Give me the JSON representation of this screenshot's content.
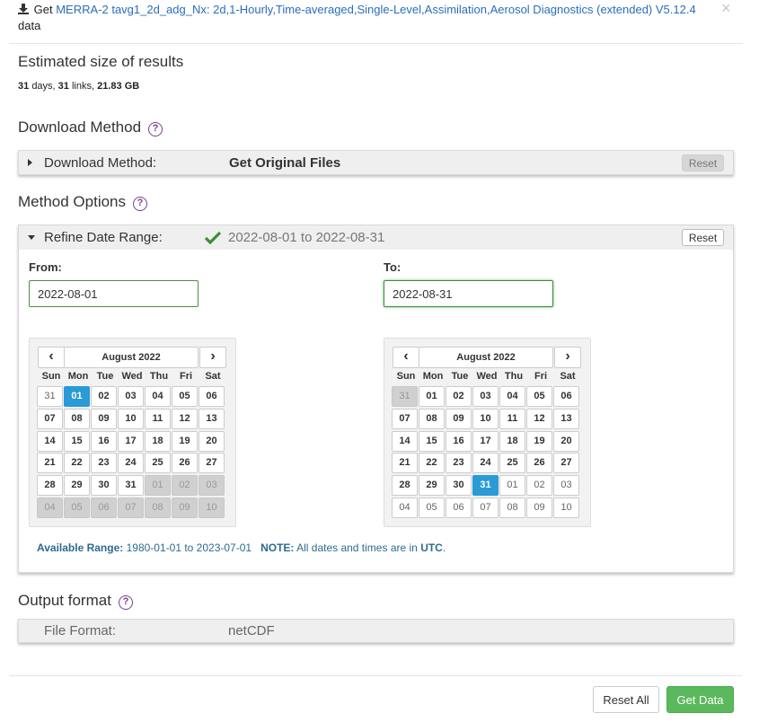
{
  "header": {
    "prefix": "Get",
    "dataset_link": "MERRA-2 tavg1_2d_adg_Nx: 2d,1-Hourly,Time-averaged,Single-Level,Assimilation,Aerosol Diagnostics (extended) V5.12.4",
    "suffix": "data",
    "close": "×"
  },
  "estimate": {
    "title": "Estimated size of results",
    "days": "31",
    "days_label": "days,",
    "links": "31",
    "links_label": "links,",
    "size": "21.83 GB"
  },
  "download_method": {
    "title": "Download Method",
    "help": "?",
    "label": "Download Method:",
    "value": "Get Original Files",
    "reset": "Reset"
  },
  "method_options": {
    "title": "Method Options",
    "help": "?",
    "refine_label": "Refine Date Range:",
    "refine_value": "2022-08-01 to 2022-08-31",
    "reset": "Reset",
    "from_label": "From:",
    "from_value": "2022-08-01",
    "to_label": "To:",
    "to_value": "2022-08-31",
    "from_calendar": {
      "title": "August 2022",
      "prev": "‹",
      "next": "›",
      "dow": [
        "Sun",
        "Mon",
        "Tue",
        "Wed",
        "Thu",
        "Fri",
        "Sat"
      ],
      "days": [
        {
          "d": "31",
          "state": "other"
        },
        {
          "d": "01",
          "state": "active"
        },
        {
          "d": "02",
          "state": "normal"
        },
        {
          "d": "03",
          "state": "normal"
        },
        {
          "d": "04",
          "state": "normal"
        },
        {
          "d": "05",
          "state": "normal"
        },
        {
          "d": "06",
          "state": "normal"
        },
        {
          "d": "07",
          "state": "normal"
        },
        {
          "d": "08",
          "state": "normal"
        },
        {
          "d": "09",
          "state": "normal"
        },
        {
          "d": "10",
          "state": "normal"
        },
        {
          "d": "11",
          "state": "normal"
        },
        {
          "d": "12",
          "state": "normal"
        },
        {
          "d": "13",
          "state": "normal"
        },
        {
          "d": "14",
          "state": "normal"
        },
        {
          "d": "15",
          "state": "normal"
        },
        {
          "d": "16",
          "state": "normal"
        },
        {
          "d": "17",
          "state": "normal"
        },
        {
          "d": "18",
          "state": "normal"
        },
        {
          "d": "19",
          "state": "normal"
        },
        {
          "d": "20",
          "state": "normal"
        },
        {
          "d": "21",
          "state": "normal"
        },
        {
          "d": "22",
          "state": "normal"
        },
        {
          "d": "23",
          "state": "normal"
        },
        {
          "d": "24",
          "state": "normal"
        },
        {
          "d": "25",
          "state": "normal"
        },
        {
          "d": "26",
          "state": "normal"
        },
        {
          "d": "27",
          "state": "normal"
        },
        {
          "d": "28",
          "state": "normal"
        },
        {
          "d": "29",
          "state": "normal"
        },
        {
          "d": "30",
          "state": "normal"
        },
        {
          "d": "31",
          "state": "normal"
        },
        {
          "d": "01",
          "state": "disabled"
        },
        {
          "d": "02",
          "state": "disabled"
        },
        {
          "d": "03",
          "state": "disabled"
        },
        {
          "d": "04",
          "state": "disabled"
        },
        {
          "d": "05",
          "state": "disabled"
        },
        {
          "d": "06",
          "state": "disabled"
        },
        {
          "d": "07",
          "state": "disabled"
        },
        {
          "d": "08",
          "state": "disabled"
        },
        {
          "d": "09",
          "state": "disabled"
        },
        {
          "d": "10",
          "state": "disabled"
        }
      ]
    },
    "to_calendar": {
      "title": "August 2022",
      "prev": "‹",
      "next": "›",
      "dow": [
        "Sun",
        "Mon",
        "Tue",
        "Wed",
        "Thu",
        "Fri",
        "Sat"
      ],
      "days": [
        {
          "d": "31",
          "state": "disabled"
        },
        {
          "d": "01",
          "state": "normal"
        },
        {
          "d": "02",
          "state": "normal"
        },
        {
          "d": "03",
          "state": "normal"
        },
        {
          "d": "04",
          "state": "normal"
        },
        {
          "d": "05",
          "state": "normal"
        },
        {
          "d": "06",
          "state": "normal"
        },
        {
          "d": "07",
          "state": "normal"
        },
        {
          "d": "08",
          "state": "normal"
        },
        {
          "d": "09",
          "state": "normal"
        },
        {
          "d": "10",
          "state": "normal"
        },
        {
          "d": "11",
          "state": "normal"
        },
        {
          "d": "12",
          "state": "normal"
        },
        {
          "d": "13",
          "state": "normal"
        },
        {
          "d": "14",
          "state": "normal"
        },
        {
          "d": "15",
          "state": "normal"
        },
        {
          "d": "16",
          "state": "normal"
        },
        {
          "d": "17",
          "state": "normal"
        },
        {
          "d": "18",
          "state": "normal"
        },
        {
          "d": "19",
          "state": "normal"
        },
        {
          "d": "20",
          "state": "normal"
        },
        {
          "d": "21",
          "state": "normal"
        },
        {
          "d": "22",
          "state": "normal"
        },
        {
          "d": "23",
          "state": "normal"
        },
        {
          "d": "24",
          "state": "normal"
        },
        {
          "d": "25",
          "state": "normal"
        },
        {
          "d": "26",
          "state": "normal"
        },
        {
          "d": "27",
          "state": "normal"
        },
        {
          "d": "28",
          "state": "normal"
        },
        {
          "d": "29",
          "state": "normal"
        },
        {
          "d": "30",
          "state": "normal"
        },
        {
          "d": "31",
          "state": "active"
        },
        {
          "d": "01",
          "state": "other"
        },
        {
          "d": "02",
          "state": "other"
        },
        {
          "d": "03",
          "state": "other"
        },
        {
          "d": "04",
          "state": "other"
        },
        {
          "d": "05",
          "state": "other"
        },
        {
          "d": "06",
          "state": "other"
        },
        {
          "d": "07",
          "state": "other"
        },
        {
          "d": "08",
          "state": "other"
        },
        {
          "d": "09",
          "state": "other"
        },
        {
          "d": "10",
          "state": "other"
        }
      ]
    },
    "available_label": "Available Range:",
    "available_value": "1980-01-01 to 2023-07-01",
    "note_label": "NOTE:",
    "note_text": "All dates and times are in",
    "note_utc": "UTC",
    "note_end": "."
  },
  "output_format": {
    "title": "Output format",
    "help": "?",
    "label": "File Format:",
    "value": "netCDF"
  },
  "footer": {
    "reset_all": "Reset All",
    "get_data": "Get Data"
  },
  "colors": {
    "link": "#2a6ebb",
    "help": "#7b3f8e",
    "calendar_active": "#2a9bd6",
    "check": "#3a8f3a",
    "get_data": "#5cb85c"
  },
  "icons": {
    "download": "download-icon",
    "check": "check-icon",
    "close": "close-icon"
  }
}
